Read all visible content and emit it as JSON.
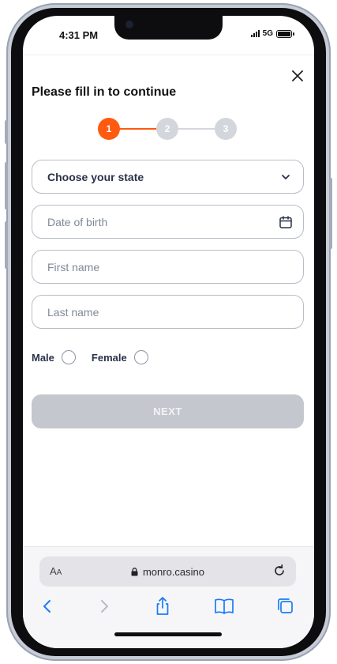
{
  "status_bar": {
    "time": "4:31 PM",
    "network": "5G"
  },
  "form": {
    "title": "Please fill in to continue",
    "steps": [
      "1",
      "2",
      "3"
    ],
    "active_step": 1,
    "state_select": {
      "label": "Choose your state"
    },
    "dob": {
      "placeholder": "Date of birth"
    },
    "first_name": {
      "placeholder": "First name"
    },
    "last_name": {
      "placeholder": "Last name"
    },
    "gender": {
      "male": "Male",
      "female": "Female"
    },
    "next_label": "NEXT"
  },
  "browser": {
    "text_size_label": "AA",
    "url": "monro.casino"
  },
  "colors": {
    "accent": "#ff5a10",
    "inactive_step": "#d3d6dc",
    "button_disabled": "#c5c7ce",
    "ios_blue": "#1a7cf5"
  },
  "icons": [
    "close-icon",
    "chevron-down-icon",
    "calendar-icon",
    "lock-icon",
    "reload-icon",
    "back-icon",
    "forward-icon",
    "share-icon",
    "bookmarks-icon",
    "tabs-icon"
  ]
}
